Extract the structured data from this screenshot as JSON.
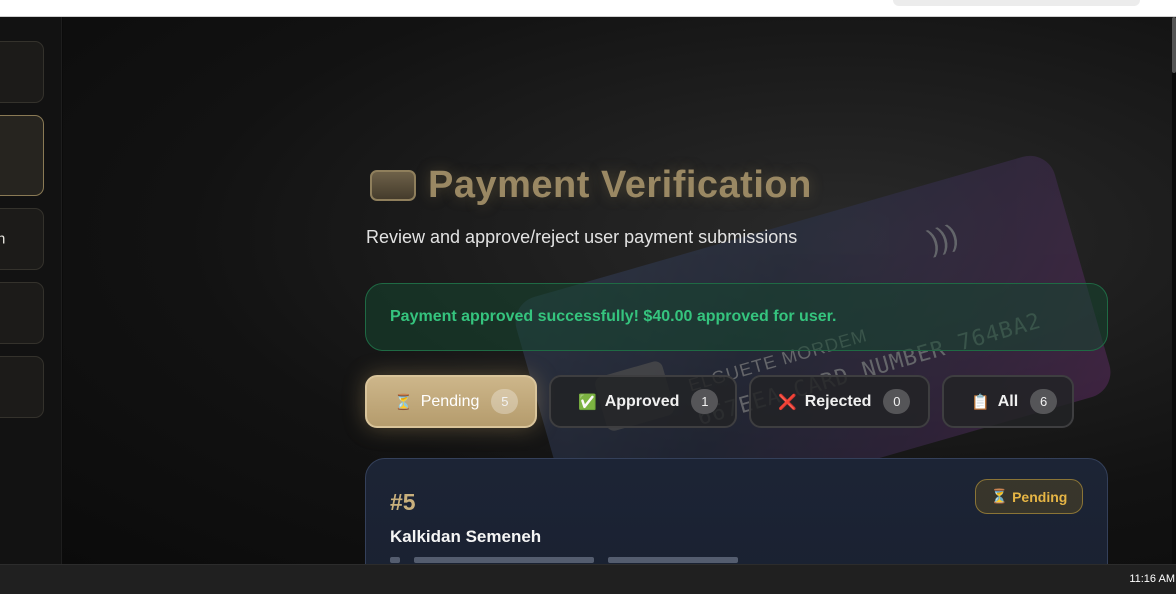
{
  "sidebar": {
    "items": [
      {
        "label": ""
      },
      {
        "label": ""
      },
      {
        "label": "n"
      },
      {
        "label": ""
      },
      {
        "label": ""
      }
    ]
  },
  "header": {
    "title": "Payment Verification",
    "subtitle": "Review and approve/reject user payment submissions"
  },
  "alert": {
    "message": "Payment approved successfully! $40.00 approved for user."
  },
  "tabs": [
    {
      "icon": "⏳",
      "label": "Pending",
      "count": "5"
    },
    {
      "icon": "✅",
      "label": "Approved",
      "count": "1"
    },
    {
      "icon": "❌",
      "label": "Rejected",
      "count": "0"
    },
    {
      "icon": "📋",
      "label": "All",
      "count": "6"
    }
  ],
  "payment": {
    "id": "#5",
    "name": "Kalkidan Semeneh",
    "status_icon": "⏳",
    "status": "Pending"
  },
  "background_card": {
    "name": "ELGUETE MORDEM",
    "number": "667EEA CARD NUMBER 764BA2"
  },
  "taskbar": {
    "clock": "11:16 AM"
  },
  "colors": {
    "accent": "#c9b07d",
    "success": "#35c47e",
    "pending": "#e6b545"
  }
}
